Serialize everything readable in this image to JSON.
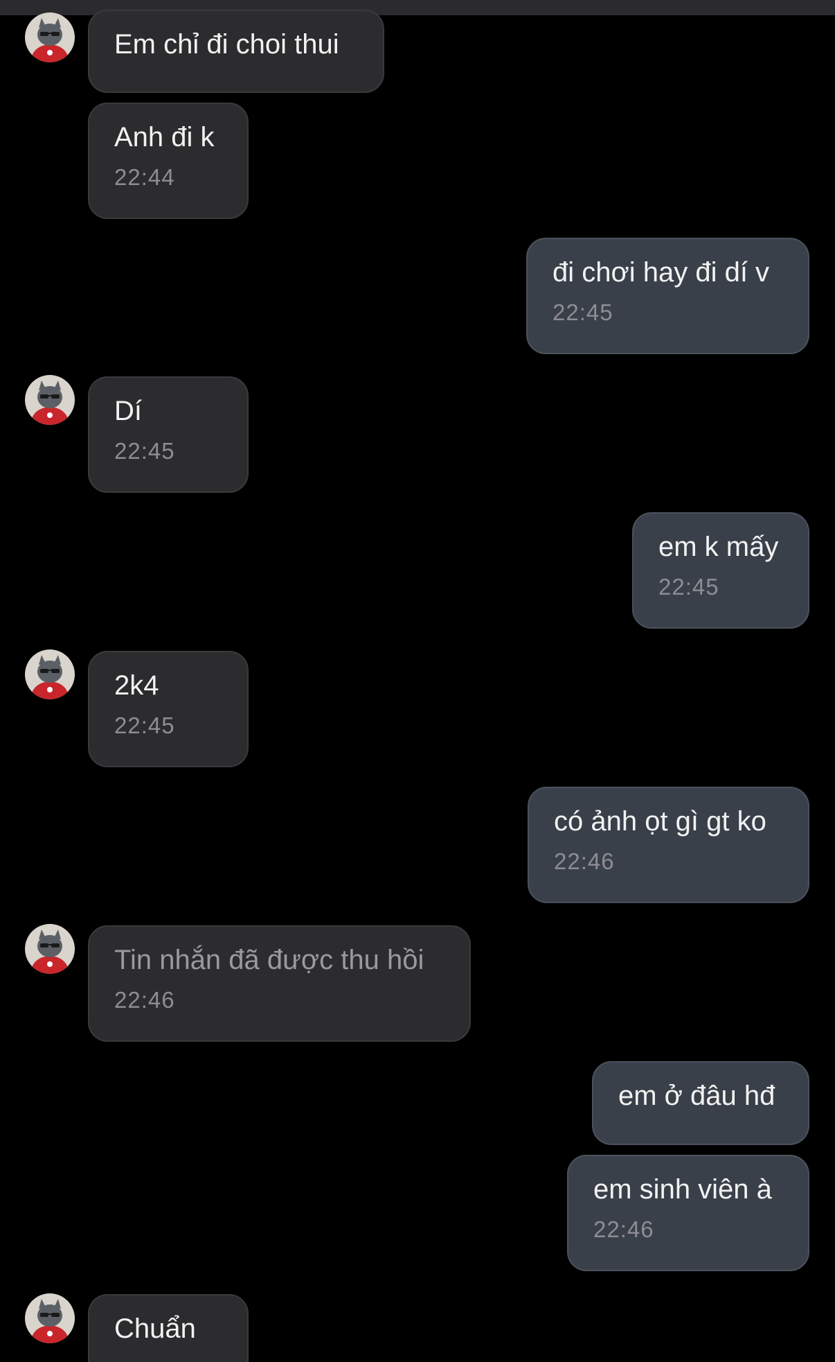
{
  "messages": [
    {
      "direction": "in",
      "text": "Em chỉ đi choi thui",
      "time": ""
    },
    {
      "direction": "in",
      "text": "Anh đi k",
      "time": "22:44"
    },
    {
      "direction": "out",
      "text": "đi chơi hay đi dí v",
      "time": "22:45"
    },
    {
      "direction": "in",
      "text": "Dí",
      "time": "22:45"
    },
    {
      "direction": "out",
      "text": "em k mấy",
      "time": "22:45"
    },
    {
      "direction": "in",
      "text": "2k4",
      "time": "22:45"
    },
    {
      "direction": "out",
      "text": "có ảnh ọt gì gt ko",
      "time": "22:46"
    },
    {
      "direction": "in",
      "text": "Tin nhắn đã được thu hồi",
      "time": "22:46",
      "recalled": true
    },
    {
      "direction": "out",
      "text": "em ở đâu hđ",
      "time": ""
    },
    {
      "direction": "out",
      "text": "em sinh viên à",
      "time": "22:46"
    },
    {
      "direction": "in",
      "text": "Chuẩn",
      "time": ""
    }
  ],
  "colors": {
    "background": "#000000",
    "incoming_bubble": "#2c2c2e",
    "outgoing_bubble": "#3a404a",
    "text": "#f2f2f2",
    "timestamp": "#8d8d93"
  },
  "icons": {
    "avatar": "contact-avatar-cat-in-red-hoodie"
  }
}
